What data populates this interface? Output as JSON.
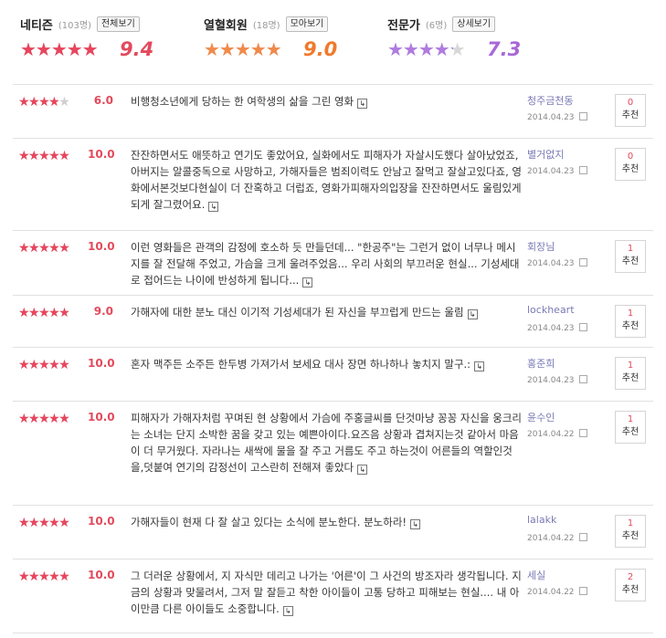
{
  "colors": {
    "accent_red": "#e24a5c",
    "group1_stars": "#e8455d",
    "group2_stars": "#f08a4b",
    "group3_stars": "#b07be0"
  },
  "summary": [
    {
      "title": "네티즌",
      "count": "(103명)",
      "button": "전체보기",
      "score": "9.4",
      "rating": 0.94,
      "color": "#e8455d",
      "score_color": "#e24a5c"
    },
    {
      "title": "열혈회원",
      "count": "(18명)",
      "button": "모아보기",
      "score": "9.0",
      "rating": 0.9,
      "color": "#f08a4b",
      "score_color": "#f07a2b"
    },
    {
      "title": "전문가",
      "count": "(6명)",
      "button": "상세보기",
      "score": "7.3",
      "rating": 0.73,
      "color": "#b07be0",
      "score_color": "#a868d8"
    }
  ],
  "reviews": [
    {
      "rating": 0.6,
      "score": "6.0",
      "text": "비행청소년에게 당하는 한 여학생의 삶을 그린 영화",
      "user": "청주금천동",
      "date": "2014.04.23",
      "rec_count": "0",
      "rec_label": "추천"
    },
    {
      "rating": 1.0,
      "score": "10.0",
      "text": "잔잔하면서도 애뜻하고 연기도 좋았어요, 실화에서도 피해자가 자살시도했다 살아났었죠, 아버지는 알콜중독으로 사망하고, 가해자들은 범죄이력도 안남고 잘먹고 잘살고있다죠, 영화에서본것보다현실이 더 잔혹하고 더럽죠, 영화가피해자의입장을 잔잔하면서도 울림있게 되게 잘그렸어요.",
      "user": "별거없지",
      "date": "2014.04.23",
      "rec_count": "0",
      "rec_label": "추천"
    },
    {
      "rating": 1.0,
      "score": "10.0",
      "text": "이런 영화들은 관객의 감정에 호소하 듯 만들던데... \"한공주\"는 그런거 없이 너무나 메시지를 잘 전달해 주었고, 가슴을 크게 울려주었음... 우리 사회의 부끄러운 현실... 기성세대로 접어드는 나이에 반성하게 됩니다...",
      "user": "회장님",
      "date": "2014.04.23",
      "rec_count": "1",
      "rec_label": "추천"
    },
    {
      "rating": 0.9,
      "score": "9.0",
      "text": "가해자에 대한 분노 대신 이기적 기성세대가 된 자신을 부끄럽게 만드는 울림",
      "user": "lockheart",
      "date": "2014.04.23",
      "rec_count": "1",
      "rec_label": "추천"
    },
    {
      "rating": 1.0,
      "score": "10.0",
      "text": "혼자 맥주든 소주든 한두병 가져가서 보세요 대사 장면 하나하나 놓치지 말구.:",
      "user": "홍준희",
      "date": "2014.04.23",
      "rec_count": "1",
      "rec_label": "추천"
    },
    {
      "rating": 1.0,
      "score": "10.0",
      "text": "피해자가 가해자처럼 꾸며된 현 상황에서 가슴에 주홍글씨를 단것마냥 꽁꽁 자신을 웅크리는 소녀는 단지 소박한 꿈을 갖고 있는 예쁜아이다.요즈음 상황과 겹쳐지는것 같아서 마음이 더 무거웠다. 자라나는 새싹에 물을 잘 주고 거름도 주고 하는것이 어른들의 역할인것을,덧붙여 연기의 감정선이 고스란히 전해져 좋았다",
      "user": "윤수인",
      "date": "2014.04.22",
      "rec_count": "1",
      "rec_label": "추천"
    },
    {
      "rating": 1.0,
      "score": "10.0",
      "text": "가해자들이 현재 다 잘 살고 있다는 소식에 분노한다. 분노하라!",
      "user": "lalakk",
      "date": "2014.04.22",
      "rec_count": "1",
      "rec_label": "추천"
    },
    {
      "rating": 1.0,
      "score": "10.0",
      "text": "그 더러운 상황에서, 지 자식만 데리고 나가는 '어른'이 그 사건의 방조자라 생각됩니다. 지금의 상황과 맞물려서, 그저 말 잘듣고 착한 아이들이 고통 당하고 피해보는 현실.... 내 아이만큼 다른 아이들도 소중합니다.",
      "user": "세실",
      "date": "2014.04.22",
      "rec_count": "2",
      "rec_label": "추천"
    }
  ]
}
